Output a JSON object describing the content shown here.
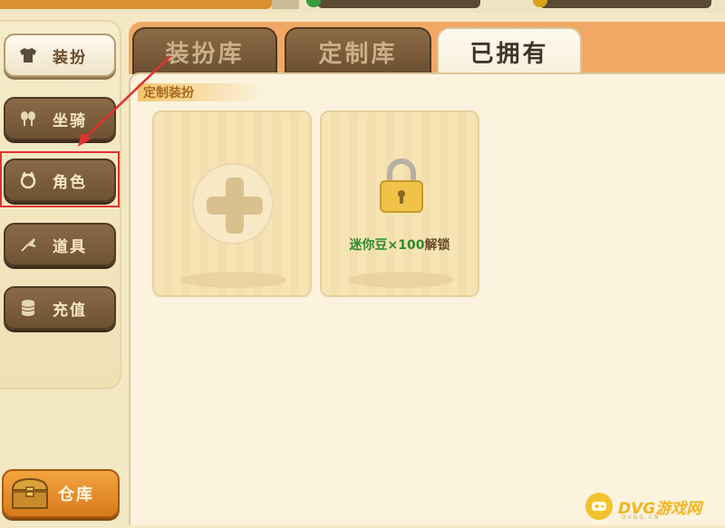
{
  "sidebar": {
    "items": [
      {
        "label": "装扮",
        "icon": "shirt-icon",
        "state": "active"
      },
      {
        "label": "坐骑",
        "icon": "mount-icon",
        "state": "normal"
      },
      {
        "label": "角色",
        "icon": "character-icon",
        "state": "normal",
        "highlighted": true
      },
      {
        "label": "道具",
        "icon": "item-icon",
        "state": "normal"
      },
      {
        "label": "充值",
        "icon": "coins-icon",
        "state": "normal"
      }
    ],
    "warehouse_label": "仓库"
  },
  "tabs": [
    {
      "label": "装扮库",
      "active": false
    },
    {
      "label": "定制库",
      "active": false
    },
    {
      "label": "已拥有",
      "active": true
    }
  ],
  "section": {
    "title": "定制装扮"
  },
  "cards": {
    "add": {
      "icon": "plus-icon"
    },
    "locked": {
      "icon": "lock-icon",
      "currency": "迷你豆",
      "amount": "×100",
      "action": "解锁"
    }
  },
  "watermark": {
    "text": "DVG游戏网",
    "sub": "DVGG.CN"
  },
  "colors": {
    "accent_orange": "#f1a864",
    "highlight_red": "#e03030",
    "price_green": "#2d8a2d"
  }
}
